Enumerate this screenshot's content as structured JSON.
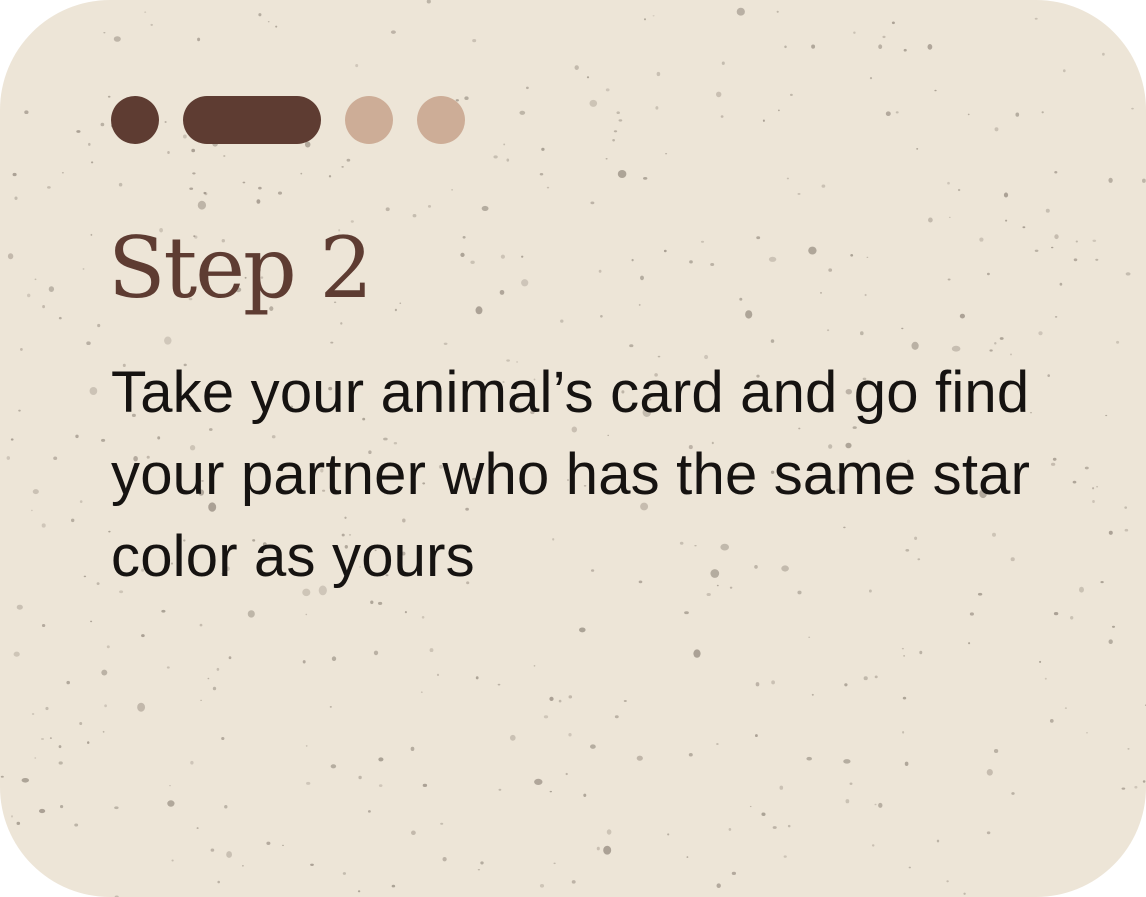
{
  "colors": {
    "background": "#EDE5D7",
    "speckle": "#9A9084",
    "accent_dark": "#5E3C32",
    "accent_light": "#CDAD97",
    "title": "#5E3C32",
    "body_text": "#161311"
  },
  "stepper": {
    "current_step": 2,
    "total_steps": 4,
    "steps": [
      {
        "state": "completed"
      },
      {
        "state": "active"
      },
      {
        "state": "upcoming"
      },
      {
        "state": "upcoming"
      }
    ]
  },
  "card": {
    "title": "Step 2",
    "body": "Take your animal’s card and go find your partner who has the same star color as yours"
  }
}
